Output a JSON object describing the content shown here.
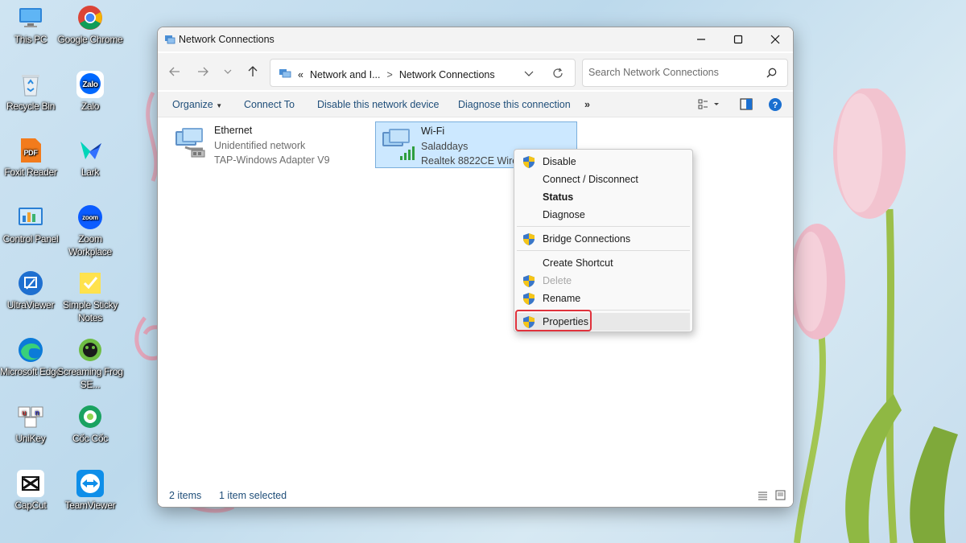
{
  "desktop": {
    "icons": [
      {
        "label": "This PC",
        "icon": "monitor-icon"
      },
      {
        "label": "Google Chrome",
        "icon": "chrome-icon"
      },
      {
        "label": "Recycle Bin",
        "icon": "recycle-bin-icon"
      },
      {
        "label": "Zalo",
        "icon": "zalo-icon"
      },
      {
        "label": "Foxit Reader",
        "icon": "foxit-icon"
      },
      {
        "label": "Lark",
        "icon": "lark-icon"
      },
      {
        "label": "Control Panel",
        "icon": "control-panel-icon"
      },
      {
        "label": "Zoom Workplace",
        "icon": "zoom-icon"
      },
      {
        "label": "UltraViewer",
        "icon": "ultraviewer-icon"
      },
      {
        "label": "Simple Sticky Notes",
        "icon": "sticky-notes-icon"
      },
      {
        "label": "Microsoft Edge",
        "icon": "edge-icon"
      },
      {
        "label": "Screaming Frog SE...",
        "icon": "screaming-frog-icon"
      },
      {
        "label": "UniKey",
        "icon": "unikey-icon"
      },
      {
        "label": "Cốc Cốc",
        "icon": "coccoc-icon"
      },
      {
        "label": "CapCut",
        "icon": "capcut-icon"
      },
      {
        "label": "TeamViewer",
        "icon": "teamviewer-icon"
      }
    ]
  },
  "window": {
    "title": "Network Connections",
    "breadcrumb": {
      "overflow": "«",
      "parent": "Network and I...",
      "separator": ">",
      "current": "Network Connections"
    },
    "search_placeholder": "Search Network Connections",
    "commands": {
      "organize": "Organize",
      "connect_to": "Connect To",
      "disable_device": "Disable this network device",
      "diagnose": "Diagnose this connection",
      "more": "»"
    },
    "connections": [
      {
        "name": "Ethernet",
        "status": "Unidentified network",
        "adapter": "TAP-Windows Adapter V9",
        "selected": false
      },
      {
        "name": "Wi-Fi",
        "status": "Saladdays",
        "adapter": "Realtek 8822CE Wirele",
        "selected": true
      }
    ],
    "statusbar": {
      "items_count": "2 items",
      "selected_count": "1 item selected"
    }
  },
  "context_menu": {
    "items": [
      {
        "label": "Disable",
        "shield": true,
        "bold": false,
        "disabled": false
      },
      {
        "label": "Connect / Disconnect",
        "shield": false,
        "bold": false,
        "disabled": false
      },
      {
        "label": "Status",
        "shield": false,
        "bold": true,
        "disabled": false
      },
      {
        "label": "Diagnose",
        "shield": false,
        "bold": false,
        "disabled": false
      },
      {
        "label": "Bridge Connections",
        "shield": true,
        "bold": false,
        "disabled": false
      },
      {
        "label": "Create Shortcut",
        "shield": false,
        "bold": false,
        "disabled": false
      },
      {
        "label": "Delete",
        "shield": true,
        "bold": false,
        "disabled": true
      },
      {
        "label": "Rename",
        "shield": true,
        "bold": false,
        "disabled": false
      },
      {
        "label": "Properties",
        "shield": true,
        "bold": false,
        "disabled": false,
        "highlighted": true
      }
    ]
  },
  "colors": {
    "accent_highlight": "#e0323c",
    "selection": "#cce8ff",
    "command_text": "#1f4e79"
  }
}
